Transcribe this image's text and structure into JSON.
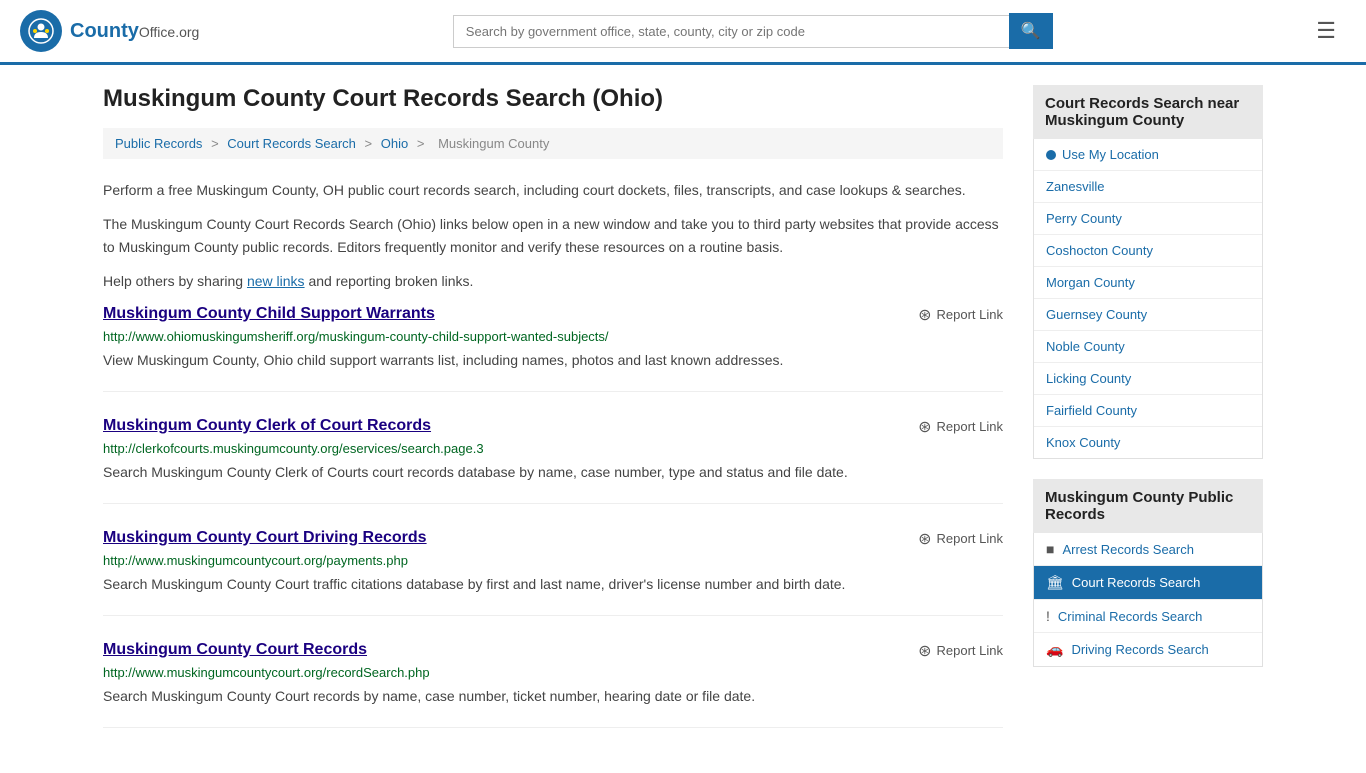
{
  "header": {
    "logo_text": "County",
    "logo_suffix": "Office.org",
    "search_placeholder": "Search by government office, state, county, city or zip code"
  },
  "page": {
    "title": "Muskingum County Court Records Search (Ohio)",
    "breadcrumb": {
      "items": [
        "Public Records",
        "Court Records Search",
        "Ohio",
        "Muskingum County"
      ]
    },
    "intro1": "Perform a free Muskingum County, OH public court records search, including court dockets, files, transcripts, and case lookups & searches.",
    "intro2": "The Muskingum County Court Records Search (Ohio) links below open in a new window and take you to third party websites that provide access to Muskingum County public records. Editors frequently monitor and verify these resources on a routine basis.",
    "intro3_pre": "Help others by sharing ",
    "intro3_link": "new links",
    "intro3_post": " and reporting broken links.",
    "results": [
      {
        "title": "Muskingum County Child Support Warrants",
        "url": "http://www.ohiomuskingumsheriff.org/muskingum-county-child-support-wanted-subjects/",
        "description": "View Muskingum County, Ohio child support warrants list, including names, photos and last known addresses.",
        "report_label": "Report Link"
      },
      {
        "title": "Muskingum County Clerk of Court Records",
        "url": "http://clerkofcourts.muskingumcounty.org/eservices/search.page.3",
        "description": "Search Muskingum County Clerk of Courts court records database by name, case number, type and status and file date.",
        "report_label": "Report Link"
      },
      {
        "title": "Muskingum County Court Driving Records",
        "url": "http://www.muskingumcountycourt.org/payments.php",
        "description": "Search Muskingum County Court traffic citations database by first and last name, driver's license number and birth date.",
        "report_label": "Report Link"
      },
      {
        "title": "Muskingum County Court Records",
        "url": "http://www.muskingumcountycourt.org/recordSearch.php",
        "description": "Search Muskingum County Court records by name, case number, ticket number, hearing date or file date.",
        "report_label": "Report Link"
      }
    ]
  },
  "sidebar": {
    "nearby_heading": "Court Records Search near Muskingum County",
    "location_label": "Use My Location",
    "nearby_links": [
      "Zanesville",
      "Perry County",
      "Coshocton County",
      "Morgan County",
      "Guernsey County",
      "Noble County",
      "Licking County",
      "Fairfield County",
      "Knox County"
    ],
    "public_records_heading": "Muskingum County Public Records",
    "public_records_items": [
      {
        "label": "Arrest Records Search",
        "icon": "■",
        "active": false
      },
      {
        "label": "Court Records Search",
        "icon": "🏛",
        "active": true
      },
      {
        "label": "Criminal Records Search",
        "icon": "!",
        "active": false
      },
      {
        "label": "Driving Records Search",
        "icon": "🚗",
        "active": false
      }
    ]
  }
}
